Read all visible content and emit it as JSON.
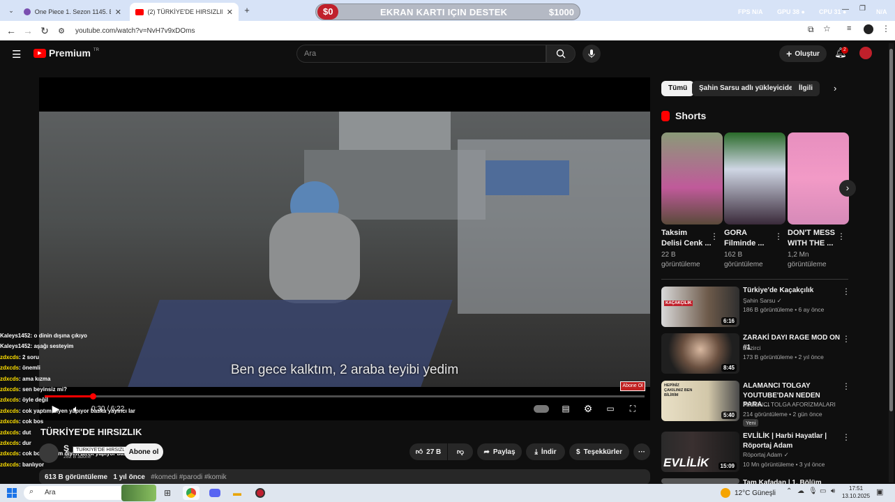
{
  "browser": {
    "tabs": [
      {
        "title": "One Piece 1. Sezon 1145. Bölüm"
      },
      {
        "title": "(2) TÜRKİYE'DE HIRSIZLIK - You"
      }
    ],
    "new_tab": "+",
    "url": "youtube.com/watch?v=NvH7v9xDOms",
    "promo": {
      "badge": "$0",
      "text": "EKRAN KARTI IÇIN DESTEK",
      "amount": "$1000"
    },
    "stats": {
      "fps_label": "FPS",
      "fps": "N/A",
      "gpu_label": "GPU",
      "gpu": "38 ●",
      "cpu_label": "CPU",
      "cpu": "31 ●",
      "ram": "N/A"
    }
  },
  "yt": {
    "logo_text": "Premium",
    "logo_region": "TR",
    "search_placeholder": "Ara",
    "create_label": "Oluştur",
    "notif_count": "2"
  },
  "video": {
    "subtitle": "Ben gece kalktım, 2 araba teyibi yedim",
    "time": "0:30 / 6:22",
    "progress": 0.08,
    "watermark": "Abone Ol",
    "title": "TÜRKİYE'DE HIRSIZLIK",
    "tooltip": "TÜRKİYE'DE HIRSIZLIK",
    "channel_initial": "Ş",
    "subscribers": "282 B abone",
    "subscribe_label": "Abone ol",
    "likes": "27 B",
    "share_label": "Paylaş",
    "download_label": "İndir",
    "thanks_label": "Teşekkürler",
    "more": "···",
    "views": "613 B görüntüleme",
    "ago": "1 yıl önce",
    "tags": "#komedi #parodi #komik"
  },
  "chat": [
    {
      "name": "Kaleys1452",
      "msg": ": o dinin dışına çıkıyo"
    },
    {
      "name": "Kaleys1452",
      "msg": ": aşağı sesteyim"
    },
    {
      "name": "zdxcds",
      "msg": ": 2 soru"
    },
    {
      "name": "zdxcds",
      "msg": ": önemli"
    },
    {
      "name": "zdxcds",
      "msg": ": ama kızma"
    },
    {
      "name": "zdxcds",
      "msg": ": sen beyinsiz mi?"
    },
    {
      "name": "zdxcds",
      "msg": ": öyle değil"
    },
    {
      "name": "zdxcds",
      "msg": ": cok yaptım diyen yapıyor baska yayıncı lar"
    },
    {
      "name": "zdxcds",
      "msg": ": cok bos"
    },
    {
      "name": "zdxcds",
      "msg": ": dut"
    },
    {
      "name": "zdxcds",
      "msg": ": dur"
    },
    {
      "name": "zdxcds",
      "msg": ": cok boş yaptım diyen direk yapıyor baska yayıncı lar"
    },
    {
      "name": "zdxcds",
      "msg": ": banlıyor"
    }
  ],
  "sidebar": {
    "chips": [
      "Tümü",
      "Şahin Sarsu adlı yükleyiciden",
      "İlgili"
    ],
    "shorts_title": "Shorts",
    "shorts": [
      {
        "title_1": "Taksim",
        "title_2": "Delisi Cenk ...",
        "views_1": "22 B",
        "views_2": "görüntüleme"
      },
      {
        "title_1": "GORA",
        "title_2": "Filminde ...",
        "views_1": "162 B",
        "views_2": "görüntüleme"
      },
      {
        "title_1": "DON'T MESS",
        "title_2": "WITH THE ...",
        "views_1": "1,2 Mn",
        "views_2": "görüntüleme"
      }
    ],
    "related": [
      {
        "title_1": "Türkiye'de Kaçakçılık",
        "title_2": "",
        "channel": "Şahin Sarsu ✓",
        "meta": "186 B görüntüleme • 6 ay önce",
        "duration": "6:16",
        "badge": "",
        "thumb_text": "KAÇAKÇILIK"
      },
      {
        "title_1": "ZARAKİ DAYI RAGE MOD ON #1",
        "title_2": "",
        "channel": "Bezirci",
        "meta": "173 B görüntüleme • 2 yıl önce",
        "duration": "8:45",
        "badge": "",
        "thumb_text": ""
      },
      {
        "title_1": "ALAMANCI TOLGAY",
        "title_2": "YOUTUBE'DAN NEDEN PARA ...",
        "channel": "ALMANCI TOLGA AFORİZMALARI",
        "meta": "214 görüntüleme • 2 gün önce",
        "duration": "5:40",
        "badge": "Yeni",
        "thumb_text": "HEPİNİZ ÇAKILINIZ BEN BİLİRİM"
      },
      {
        "title_1": "EVLİLİK | Harbi Hayatlar |",
        "title_2": "Röportaj Adam",
        "channel": "Röportaj Adam ✓",
        "meta": "10 Mn görüntüleme • 3 yıl önce",
        "duration": "15:09",
        "badge": "",
        "thumb_text": "EVLİLİK"
      },
      {
        "title_1": "Tam Kafadan | 1. Bölüm (Bipsiz",
        "title_2": "",
        "channel": "",
        "meta": "",
        "duration": "",
        "badge": "",
        "thumb_text": ""
      }
    ]
  },
  "taskbar": {
    "search": "Ara",
    "weather": "12°C Güneşli",
    "time": "17:51",
    "date": "13.10.2025"
  }
}
